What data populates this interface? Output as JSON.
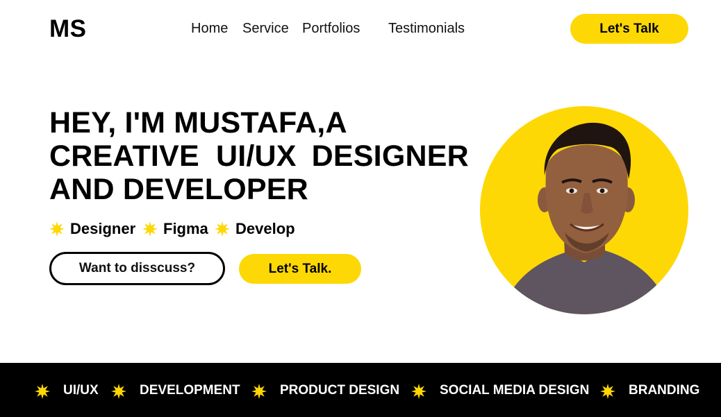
{
  "header": {
    "logo": "MS",
    "nav": [
      "Home",
      "Service",
      "Portfolios",
      "Testimonials"
    ],
    "cta_label": "Let's Talk"
  },
  "hero": {
    "title_line1": "HEY, I'M MUSTAFA,A",
    "title_line2_before": "CREATIVE",
    "title_line2_highlight": "UI/UX",
    "title_line2_after": "DESIGNER",
    "title_line3": "AND DEVELOPER",
    "tags": [
      "Designer",
      "Figma",
      "Develop"
    ],
    "secondary_button": "Want to disscuss?",
    "primary_button": "Let's Talk."
  },
  "ticker": {
    "items": [
      "UI/UX",
      "DEVELOPMENT",
      "PRODUCT DESIGN",
      "SOCIAL MEDIA DESIGN",
      "BRANDING"
    ]
  },
  "icons": {
    "tag_bullet": "starburst-icon",
    "ticker_bullet": "starburst-icon"
  },
  "colors": {
    "accent": "#fdd805",
    "dark": "#000000",
    "background": "#ffffff"
  }
}
